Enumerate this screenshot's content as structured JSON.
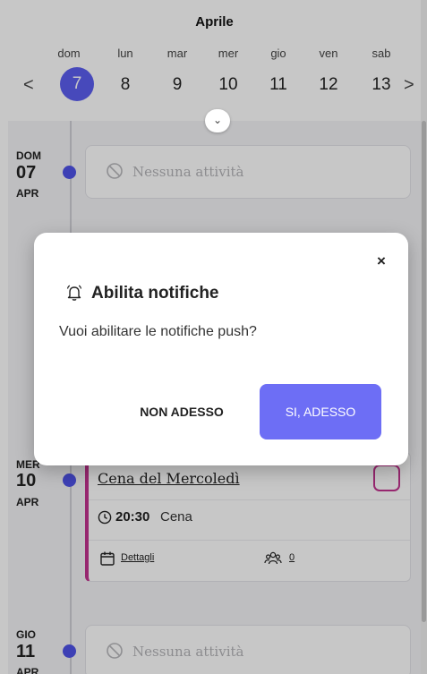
{
  "calendar": {
    "month": "Aprile",
    "days": [
      {
        "name": "dom",
        "num": "7",
        "selected": true
      },
      {
        "name": "lun",
        "num": "8"
      },
      {
        "name": "mar",
        "num": "9"
      },
      {
        "name": "mer",
        "num": "10"
      },
      {
        "name": "gio",
        "num": "11"
      },
      {
        "name": "ven",
        "num": "12"
      },
      {
        "name": "sab",
        "num": "13"
      }
    ],
    "prev_arrow": "<",
    "next_arrow": ">",
    "expand_icon": "chevron-down-icon"
  },
  "timeline": {
    "entries": [
      {
        "dow": "DOM",
        "day": "07",
        "month": "APR",
        "empty_text": "Nessuna attività"
      },
      {
        "dow": "MER",
        "day": "10",
        "month": "APR"
      },
      {
        "dow": "GIO",
        "day": "11",
        "month": "APR",
        "empty_text": "Nessuna attività"
      }
    ],
    "event": {
      "title": "Cena del Mercoledì",
      "time": "20:30",
      "kind": "Cena",
      "details_label": "Dettagli",
      "participants": "0",
      "accent_color": "#c2328f"
    }
  },
  "dialog": {
    "title": "Abilita notifiche",
    "message": "Vuoi abilitare le notifiche push?",
    "close_label": "×",
    "later_label": "NON ADESSO",
    "yes_label": "SI, ADESSO",
    "accent_color": "#6d6ef5"
  }
}
